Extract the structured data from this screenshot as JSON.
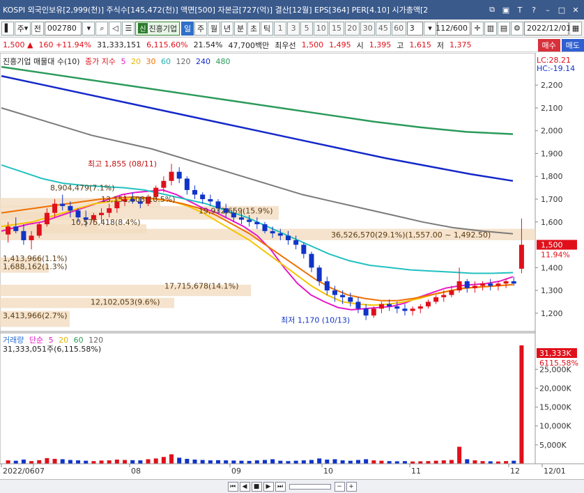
{
  "window": {
    "title": "KOSPI 외국인보유[2,999(천)] 주식수[145,472(천)] 액면[500] 자본금[727(억)] 결산[12월] EPS[364] PER[4.10] 시가총액[2"
  },
  "toolbar": {
    "period": "주",
    "prev_label": "전",
    "code": "002780",
    "stock_name": "진흥기업",
    "stock_badge": "신",
    "timeframes": [
      "일",
      "주",
      "월",
      "년",
      "분",
      "초",
      "틱"
    ],
    "selected_timeframe": "일",
    "minute_options": [
      "1",
      "3",
      "5",
      "10",
      "15",
      "20",
      "30",
      "45",
      "60"
    ],
    "interval_value": "3",
    "page_count": "112/600",
    "date": "2022/12/01"
  },
  "quote": {
    "price": "1,500",
    "change": "160",
    "change_pct": "+11.94%",
    "volume": "31,333,151",
    "volume_ratio": "6,115.60%",
    "turnover": "21.54%",
    "amount": "47,700백만",
    "best_label": "최우선",
    "ask": "1,500",
    "bid": "1,495",
    "open_label": "시",
    "open": "1,395",
    "high_label": "고",
    "high": "1,615",
    "low_label": "저",
    "low": "1,375",
    "buy_label": "매수",
    "sell_label": "매도"
  },
  "price_panel": {
    "legend_title": "진흥기업 매물대 수(10)",
    "ma_title": "종가 지수",
    "ma_periods": [
      "5",
      "20",
      "30",
      "60",
      "120",
      "240",
      "480"
    ],
    "ma_colors": [
      "#e619c8",
      "#f5c400",
      "#f07000",
      "#22c0c0",
      "#7a7a7a",
      "#1428c8",
      "#2a9a5a"
    ],
    "lc_label": "LC:28.21",
    "hc_label": "HC:-19.14",
    "current_price_tag": "1,500",
    "current_pct_tag": "11.94%",
    "high_annotation": "최고 1,855 (08/11)",
    "low_annotation": "최저 1,170 (10/13)",
    "y_ticks": [
      "2,200",
      "2,100",
      "2,000",
      "1,900",
      "1,800",
      "1,700",
      "1,600",
      "1,400",
      "1,300",
      "1,200"
    ],
    "volume_profile_labels": [
      "8,904,479(7.1%)",
      "13,151,608(10.5%)",
      "19,932,659(15.9%)",
      "10,575,418(8.4%)",
      "36,526,570(29.1%)(1,557.00 ~ 1,492.50)",
      "1,413,966(1.1%)",
      "1,688,162(1.3%)",
      "17,715,678(14.1%)",
      "12,102,053(9.6%)",
      "3,413,966(2.7%)"
    ]
  },
  "volume_panel": {
    "title": "거래량",
    "ma_title": "단순",
    "ma_periods": [
      "5",
      "20",
      "60",
      "120"
    ],
    "value_text": "31,333,051주(6,115.58%)",
    "tag_value": "31,333K",
    "tag_pct": "6115.58%",
    "y_ticks": [
      "25,000K",
      "20,000K",
      "15,000K",
      "10,000K",
      "5,000K"
    ]
  },
  "x_axis": {
    "labels": [
      "2022/06",
      "07",
      "08",
      "09",
      "10",
      "11",
      "12",
      "12/01"
    ]
  },
  "chart_data": {
    "type": "line",
    "title": "진흥기업",
    "ylim": [
      1120,
      2280
    ],
    "price_x_start": "2022/06",
    "candles": [
      [
        1545,
        1600,
        1510,
        1580
      ],
      [
        1580,
        1620,
        1550,
        1560
      ],
      [
        1560,
        1590,
        1500,
        1520
      ],
      [
        1520,
        1560,
        1480,
        1540
      ],
      [
        1540,
        1600,
        1530,
        1590
      ],
      [
        1590,
        1660,
        1580,
        1640
      ],
      [
        1640,
        1700,
        1620,
        1680
      ],
      [
        1680,
        1720,
        1650,
        1670
      ],
      [
        1670,
        1690,
        1620,
        1650
      ],
      [
        1650,
        1660,
        1600,
        1620
      ],
      [
        1620,
        1650,
        1580,
        1610
      ],
      [
        1610,
        1640,
        1590,
        1630
      ],
      [
        1630,
        1660,
        1600,
        1640
      ],
      [
        1640,
        1680,
        1620,
        1660
      ],
      [
        1660,
        1700,
        1640,
        1690
      ],
      [
        1690,
        1720,
        1670,
        1700
      ],
      [
        1700,
        1730,
        1680,
        1690
      ],
      [
        1690,
        1710,
        1660,
        1680
      ],
      [
        1680,
        1720,
        1670,
        1710
      ],
      [
        1710,
        1760,
        1700,
        1750
      ],
      [
        1750,
        1800,
        1730,
        1780
      ],
      [
        1780,
        1855,
        1760,
        1820
      ],
      [
        1820,
        1840,
        1770,
        1790
      ],
      [
        1790,
        1800,
        1720,
        1740
      ],
      [
        1740,
        1760,
        1700,
        1720
      ],
      [
        1720,
        1730,
        1680,
        1700
      ],
      [
        1700,
        1720,
        1670,
        1690
      ],
      [
        1690,
        1700,
        1640,
        1660
      ],
      [
        1660,
        1680,
        1620,
        1640
      ],
      [
        1640,
        1660,
        1600,
        1620
      ],
      [
        1620,
        1640,
        1590,
        1610
      ],
      [
        1610,
        1630,
        1580,
        1600
      ],
      [
        1600,
        1620,
        1570,
        1590
      ],
      [
        1590,
        1600,
        1550,
        1560
      ],
      [
        1560,
        1580,
        1530,
        1550
      ],
      [
        1550,
        1570,
        1520,
        1540
      ],
      [
        1540,
        1560,
        1500,
        1520
      ],
      [
        1520,
        1540,
        1480,
        1500
      ],
      [
        1500,
        1510,
        1440,
        1460
      ],
      [
        1460,
        1470,
        1380,
        1400
      ],
      [
        1400,
        1410,
        1320,
        1340
      ],
      [
        1340,
        1360,
        1280,
        1300
      ],
      [
        1300,
        1320,
        1250,
        1280
      ],
      [
        1280,
        1300,
        1240,
        1270
      ],
      [
        1270,
        1290,
        1230,
        1250
      ],
      [
        1250,
        1270,
        1200,
        1220
      ],
      [
        1220,
        1240,
        1170,
        1190
      ],
      [
        1190,
        1230,
        1180,
        1220
      ],
      [
        1220,
        1250,
        1200,
        1240
      ],
      [
        1240,
        1260,
        1210,
        1230
      ],
      [
        1230,
        1250,
        1200,
        1220
      ],
      [
        1220,
        1240,
        1190,
        1210
      ],
      [
        1210,
        1230,
        1190,
        1220
      ],
      [
        1220,
        1240,
        1200,
        1230
      ],
      [
        1230,
        1260,
        1220,
        1250
      ],
      [
        1250,
        1280,
        1240,
        1270
      ],
      [
        1270,
        1300,
        1250,
        1280
      ],
      [
        1280,
        1320,
        1270,
        1300
      ],
      [
        1300,
        1400,
        1290,
        1340
      ],
      [
        1340,
        1350,
        1290,
        1310
      ],
      [
        1310,
        1340,
        1290,
        1320
      ],
      [
        1320,
        1340,
        1300,
        1330
      ],
      [
        1330,
        1350,
        1300,
        1320
      ],
      [
        1320,
        1340,
        1300,
        1330
      ],
      [
        1330,
        1350,
        1310,
        1340
      ],
      [
        1340,
        1360,
        1320,
        1330
      ],
      [
        1395,
        1615,
        1375,
        1500
      ]
    ],
    "ma_series": [
      {
        "name": "5",
        "values": [
          1560,
          1575,
          1590,
          1600,
          1620,
          1640,
          1660,
          1680,
          1700,
          1720,
          1730,
          1735,
          1740,
          1720,
          1690,
          1660,
          1640,
          1610,
          1580,
          1540,
          1480,
          1400,
          1330,
          1280,
          1250,
          1225,
          1215,
          1220,
          1225,
          1230,
          1245,
          1270,
          1290,
          1310,
          1320,
          1325,
          1330,
          1340,
          1360
        ]
      },
      {
        "name": "20",
        "values": [
          1580,
          1590,
          1600,
          1620,
          1640,
          1660,
          1680,
          1690,
          1700,
          1705,
          1700,
          1690,
          1670,
          1640,
          1600,
          1560,
          1520,
          1470,
          1420,
          1370,
          1320,
          1280,
          1250,
          1240,
          1235,
          1240,
          1250,
          1265,
          1285,
          1300,
          1310,
          1315,
          1320,
          1325
        ]
      },
      {
        "name": "30",
        "values": [
          1640,
          1650,
          1660,
          1670,
          1680,
          1690,
          1700,
          1705,
          1710,
          1705,
          1695,
          1680,
          1660,
          1630,
          1590,
          1550,
          1500,
          1450,
          1400,
          1350,
          1310,
          1280,
          1265,
          1255,
          1255,
          1265,
          1280,
          1295,
          1310,
          1315,
          1320,
          1325
        ]
      },
      {
        "name": "60",
        "values": [
          1850,
          1820,
          1790,
          1770,
          1760,
          1755,
          1750,
          1740,
          1720,
          1700,
          1680,
          1650,
          1620,
          1580,
          1540,
          1500,
          1460,
          1430,
          1410,
          1400,
          1390,
          1385,
          1380,
          1375,
          1375,
          1378
        ]
      },
      {
        "name": "120",
        "values": [
          2100,
          2060,
          2020,
          1980,
          1950,
          1920,
          1880,
          1840,
          1800,
          1760,
          1720,
          1690,
          1660,
          1630,
          1600,
          1575,
          1560,
          1548
        ]
      },
      {
        "name": "240",
        "values": [
          2240,
          2200,
          2160,
          2120,
          2080,
          2040,
          2000,
          1960,
          1920,
          1880,
          1845,
          1810,
          1780
        ]
      },
      {
        "name": "480",
        "values": [
          2280,
          2250,
          2220,
          2190,
          2160,
          2130,
          2100,
          2070,
          2040,
          2015,
          1995,
          1985
        ]
      }
    ],
    "volume": [
      900,
      800,
      1100,
      700,
      950,
      1500,
      1300,
      1200,
      1000,
      900,
      800,
      700,
      850,
      900,
      1100,
      1000,
      950,
      900,
      1200,
      1400,
      1800,
      2500,
      1600,
      1300,
      1100,
      1000,
      900,
      950,
      900,
      850,
      800,
      750,
      900,
      1000,
      1200,
      800,
      700,
      800,
      900,
      1000,
      1400,
      1100,
      1200,
      900,
      800,
      1000,
      1200,
      900,
      800,
      700,
      650,
      700,
      600,
      650,
      700,
      800,
      900,
      1000,
      4500,
      1200,
      900,
      700,
      650,
      600,
      700,
      800,
      31333
    ],
    "volume_ylim": [
      0,
      31333
    ]
  }
}
